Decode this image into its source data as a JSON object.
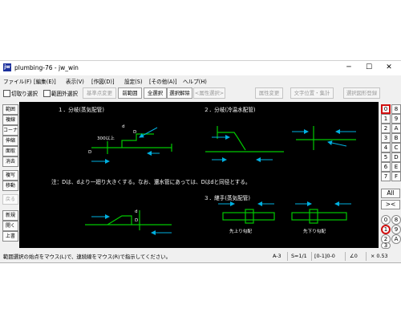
{
  "window": {
    "title": "plumbing-76 - jw_win",
    "icon_text": "jw",
    "controls": {
      "minimize": "─",
      "maximize": "☐",
      "close": "✕"
    }
  },
  "menu": [
    "ファイル(F)",
    "[編集(E)]",
    "表示(V)",
    "[作図(D)]",
    "設定(S)",
    "[その他(A)]",
    "ヘルプ(H)"
  ],
  "toolbar": {
    "cut_select": "切取り選択",
    "out_of_range": "範囲外選択",
    "base_change": "基準点変更",
    "prev_range": "前範囲",
    "select_all": "全選択",
    "deselect": "選択解除",
    "attr_select": "<属性選択>",
    "attr_change": "属性変更",
    "text_pos": "文字位置・集計",
    "register": "選択図形登録"
  },
  "left_tools": [
    "範囲",
    "複線",
    "コーナー",
    "伸縮",
    "面取",
    "消去",
    "複写",
    "移動",
    "戻る",
    "新規",
    "開く",
    "上書"
  ],
  "right_tools": {
    "layer_groups": [
      "0",
      "1",
      "2",
      "3",
      "4",
      "5",
      "6",
      "7"
    ],
    "layers": [
      "8",
      "9",
      "A",
      "B",
      "C",
      "D",
      "E",
      "F"
    ],
    "all": "All",
    "cross": "><",
    "bottom": [
      "0",
      "1",
      "2",
      "3"
    ]
  },
  "drawing": {
    "h1": "１．分岐(蒸気配管)",
    "h2": "２．分岐(冷温水配管)",
    "h3": "３．継手(蒸気配管)",
    "note": "注：Dは、dより一廻り大きくする。なお、還水管にあっては、Dはdと同径とする。",
    "label_300": "300以上",
    "label_d": "d",
    "label_D": "D",
    "fitting_up": "先上り勾配",
    "fitting_down": "先下り勾配"
  },
  "status": {
    "message": "範囲選択の始点をマウス(L)で、連続線をマウス(R)で指示してください。",
    "paper": "A-3",
    "scale": "S=1/1",
    "layer": "[0-1]0-0",
    "angle": "∠0",
    "zoom": "× 0.53"
  },
  "colors": {
    "canvas": "#000000",
    "pipe": "#00c800",
    "arrow": "#00b0e0",
    "text": "#ffffff",
    "active": "#d01010"
  }
}
